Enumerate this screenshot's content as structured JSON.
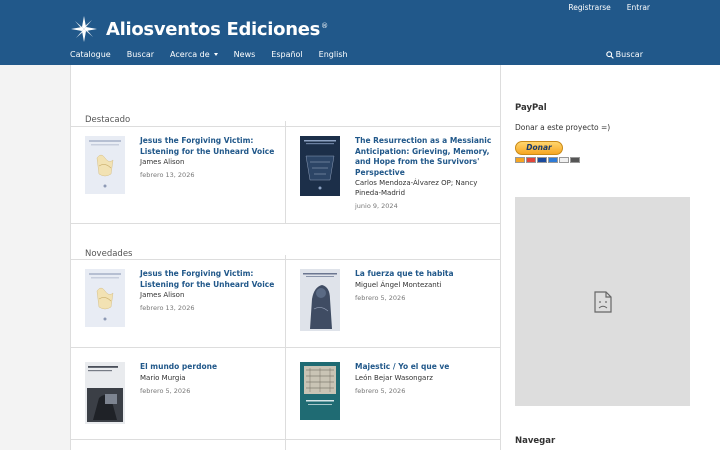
{
  "header": {
    "brand_name": "Aliosventos Ediciones",
    "brand_reg": "®",
    "user_nav": {
      "register": "Registrarse",
      "login": "Entrar"
    },
    "nav": {
      "catalogue": "Catalogue",
      "search": "Buscar",
      "about": "Acerca de",
      "news": "News",
      "spanish": "Español",
      "english": "English"
    },
    "search_link": "Buscar"
  },
  "featured": {
    "title": "Destacado",
    "books": [
      {
        "title": "Jesus the Forgiving Victim: Listening for the Unheard Voice",
        "author": "James Alison",
        "date": "febrero 13, 2026"
      },
      {
        "title": "The Resurrection as a Messianic Anticipation: Grieving, Memory, and Hope from the Survivors' Perspective",
        "author": "Carlos Mendoza-Álvarez OP; Nancy Pineda-Madrid",
        "date": "junio 9, 2024"
      }
    ]
  },
  "new_releases": {
    "title": "Novedades",
    "books": [
      {
        "title": "Jesus the Forgiving Victim: Listening for the Unheard Voice",
        "author": "James Alison",
        "date": "febrero 13, 2026"
      },
      {
        "title": "La fuerza que te habita",
        "author": "Miguel Ángel Montezanti",
        "date": "febrero 5, 2026"
      },
      {
        "title": "El mundo perdone",
        "author": "Mario Murgia",
        "date": "febrero 5, 2026"
      },
      {
        "title": "Majestic / Yo el que ve",
        "author": "León Bejar Wasongarz",
        "date": "febrero 5, 2026"
      }
    ]
  },
  "sidebar": {
    "paypal_title": "PayPal",
    "paypal_text": "Donar a este proyecto =)",
    "donate_label": "Donar",
    "navigate_title": "Navegar"
  },
  "icons": {
    "brand": "star-logo-icon",
    "search": "search-icon",
    "caret": "caret-down-icon",
    "broken_image": "broken-image-icon"
  },
  "colors": {
    "primary": "#21588a",
    "background": "#f3f3f3"
  }
}
